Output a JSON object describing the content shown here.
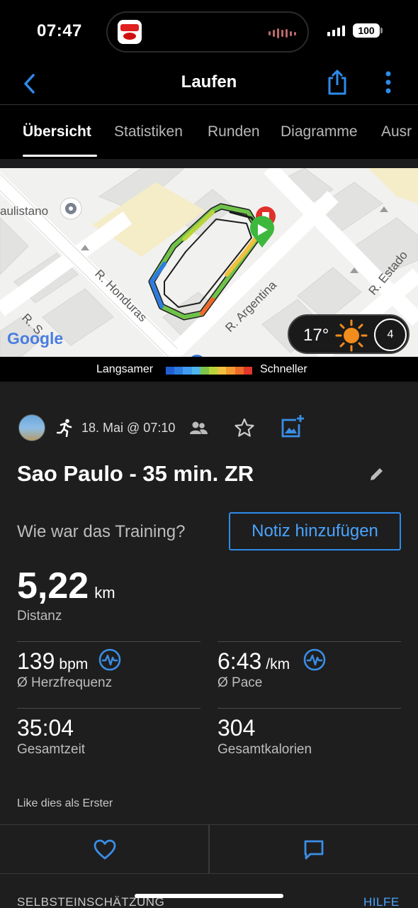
{
  "status_bar": {
    "time": "07:47",
    "battery": "100",
    "island_app": "FORO-TERESA",
    "icons": [
      "signal-icon",
      "battery-icon"
    ]
  },
  "nav": {
    "title": "Laufen",
    "icons": [
      "back-chevron-icon",
      "share-icon",
      "more-vertical-icon"
    ]
  },
  "tabs": [
    {
      "label": "Übersicht",
      "active": true
    },
    {
      "label": "Statistiken",
      "active": false
    },
    {
      "label": "Runden",
      "active": false
    },
    {
      "label": "Diagramme",
      "active": false
    },
    {
      "label": "Ausr",
      "active": false
    }
  ],
  "map": {
    "labels": {
      "paulistano": "aulistano",
      "honduras": "R. Honduras",
      "argentina": "R. Argentina",
      "estados": "R. Estado",
      "bottom_left": "R. S",
      "bottom_left2": "S"
    },
    "google_logo": "Google",
    "weather": {
      "temp": "17°",
      "wind": "4",
      "icons": [
        "sun-icon",
        "wind-direction-icon"
      ]
    }
  },
  "legend": {
    "slow": "Langsamer",
    "fast": "Schneller",
    "colors": [
      "#1f5fd1",
      "#2e7ce0",
      "#3f9cf0",
      "#4fb6e8",
      "#7ec64a",
      "#b8d43a",
      "#f0c040",
      "#f29a30",
      "#ee6a2a",
      "#e0382a"
    ]
  },
  "activity": {
    "date": "18. Mai @ 07:10",
    "title": "Sao Paulo - 35 min. ZR",
    "question": "Wie war das Training?",
    "note_button": "Notiz hinzufügen",
    "distance": {
      "value": "5,22",
      "unit": "km",
      "label": "Distanz"
    },
    "stats": [
      {
        "value": "139",
        "unit": "bpm",
        "label": "Ø Herzfrequenz",
        "icon": true
      },
      {
        "value": "6:43",
        "unit": "/km",
        "label": "Ø Pace",
        "icon": true
      },
      {
        "value": "35:04",
        "unit": "",
        "label": "Gesamtzeit",
        "icon": false
      },
      {
        "value": "304",
        "unit": "",
        "label": "Gesamtkalorien",
        "icon": false
      }
    ],
    "like_text": "Like dies als Erster"
  },
  "bottom": {
    "section_title": "SELBSTEINSCHÄTZUNG",
    "help": "HILFE"
  },
  "accent_color": "#4aa3ff"
}
